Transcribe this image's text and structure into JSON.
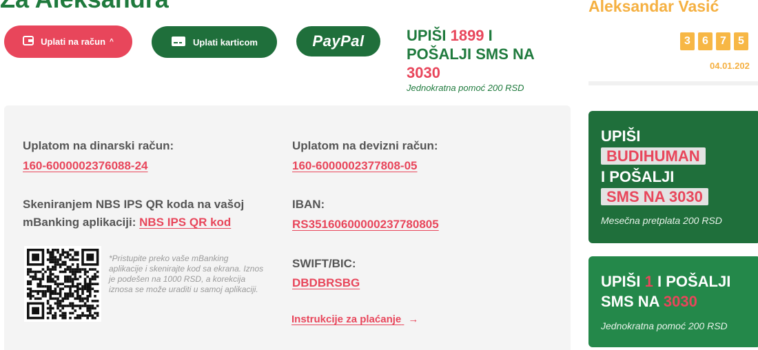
{
  "header": {
    "title": "Za Aleksandra"
  },
  "buttons": {
    "bank_label": "Uplati na račun",
    "card_label": "Uplati karticom",
    "paypal_label": "PayPal"
  },
  "sms_promo": {
    "l1_text": "UPIŠI",
    "l1_num": "1899",
    "l1_end": "I",
    "l2": "POŠALJI SMS NA",
    "l3": "3030",
    "sub": "Jednokratna pomoć 200 RSD"
  },
  "beneficiary": {
    "name": "Aleksandar Vasić",
    "counter_digits": [
      "3",
      "6",
      "7",
      "5"
    ],
    "date": "04.01.202"
  },
  "payment": {
    "dinar_label": "Uplatom na dinarski račun:",
    "dinar_account": "160-6000002376088-24",
    "foreign_label": "Uplatom na devizni račun:",
    "foreign_account": "160-6000002377808-05",
    "qr_label_1": "Skeniranjem NBS IPS QR koda na vašoj",
    "qr_label_2": "mBanking aplikaciji:",
    "qr_link": "NBS IPS QR kod",
    "iban_label": "IBAN:",
    "iban": "RS35160600000237780805",
    "swift_label": "SWIFT/BIC:",
    "swift": "DBDBRSBG",
    "qr_note": "*Pristupite preko vaše mBanking aplikacije i skenirajte kod sa ekrana. Iznos je podešen na 1000 RSD, a korekcija iznosa se može uraditi u samoj aplikaciji.",
    "instructions": "Instrukcije za plaćanje"
  },
  "card_subscription": {
    "l1": "UPIŠI",
    "pill1": "BUDIHUMAN",
    "l2": "I POŠALJI",
    "pill2": "SMS NA 3030",
    "note": "Mesečna pretplata 200 RSD"
  },
  "card_onetime": {
    "l1_a": "UPIŠI",
    "l1_num": "1",
    "l1_b": "I POŠALJI",
    "l2_a": "SMS NA",
    "l2_num": "3030",
    "note": "Jednokratna pomoć 200 RSD"
  },
  "colors": {
    "red": "#e8465b",
    "green": "#1f6f3b",
    "orange": "#f5b041"
  },
  "icons": [
    "wallet-icon",
    "credit-card-icon",
    "arrow-right-icon",
    "chevron-up-icon"
  ]
}
